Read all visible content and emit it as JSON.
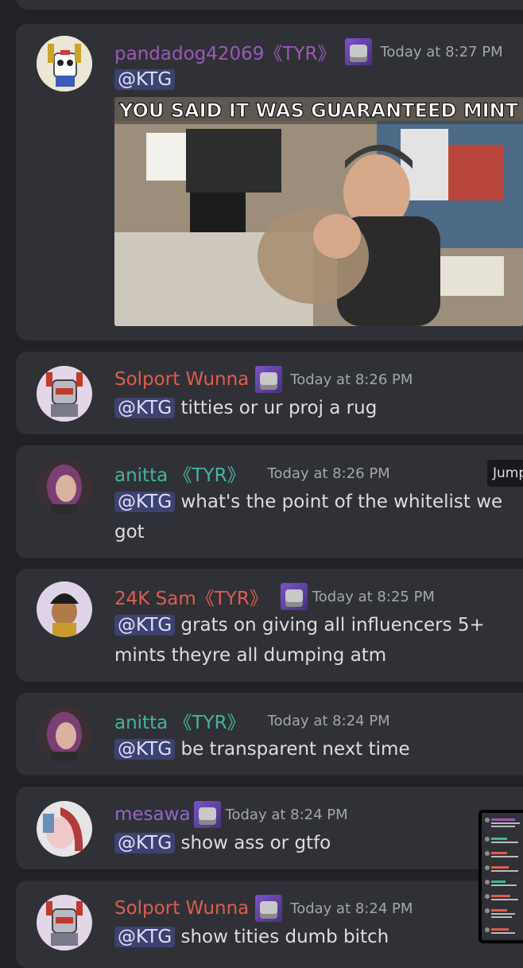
{
  "messages": [
    {
      "username": "pandadog42069《TYR》",
      "timestamp": "Today at 8:27 PM",
      "mention": "@KTG",
      "text": "",
      "image_caption": "YOU SAID IT WAS GUARANTEED MINT",
      "name_color": "#9b59b6"
    },
    {
      "username": "Solport Wunna",
      "timestamp": "Today at 8:26 PM",
      "mention": "@KTG",
      "text": "titties or ur proj a rug",
      "name_color": "#e05c4f"
    },
    {
      "username": "anitta 《TYR》",
      "timestamp": "Today at 8:26 PM",
      "mention": "@KTG",
      "text": "what's the point of the whitelist we",
      "text_line2": "got",
      "name_color": "#43b59b"
    },
    {
      "username": "24K Sam《TYR》",
      "timestamp": "Today at 8:25 PM",
      "mention": "@KTG",
      "text": "grats on giving all influencers 5+",
      "text_line2": "mints theyre all dumping atm",
      "name_color": "#e05c4f"
    },
    {
      "username": "anitta 《TYR》",
      "timestamp": "Today at 8:24 PM",
      "mention": "@KTG",
      "text": "be transparent next time",
      "name_color": "#43b59b"
    },
    {
      "username": "mesawa",
      "timestamp": "Today at 8:24 PM",
      "mention": "@KTG",
      "text": "show ass or gtfo",
      "name_color": "#9467c9"
    },
    {
      "username": "Solport Wunna",
      "timestamp": "Today at 8:24 PM",
      "mention": "@KTG",
      "text": "show tities dumb bitch",
      "name_color": "#e05c4f"
    }
  ],
  "jump_label": "Jump",
  "colors": {
    "background": "#202225",
    "card": "#2f3136",
    "mention_bg": "#3d4270",
    "timestamp": "#a3a6aa"
  }
}
